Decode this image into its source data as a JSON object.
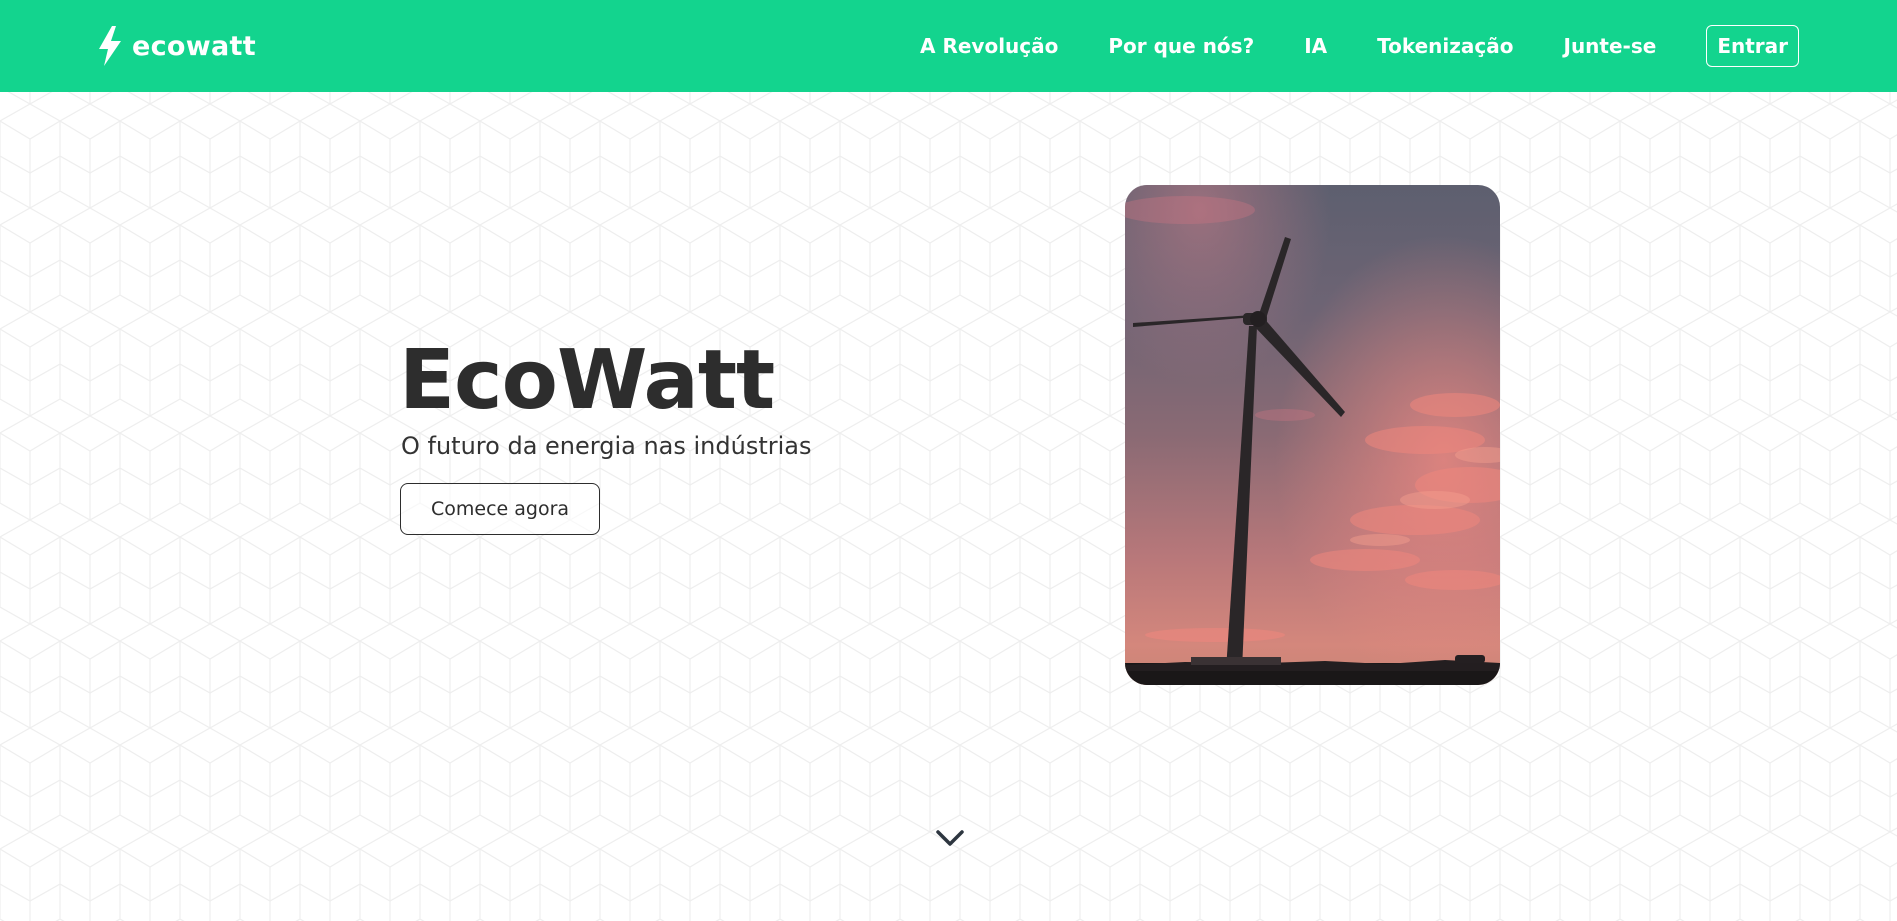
{
  "brand": {
    "name": "ecowatt",
    "icon": "lightning-bolt-icon"
  },
  "nav": {
    "links": [
      {
        "label": "A Revolução"
      },
      {
        "label": "Por que nós?"
      },
      {
        "label": "IA"
      },
      {
        "label": "Tokenização"
      },
      {
        "label": "Junte-se"
      }
    ],
    "login_label": "Entrar"
  },
  "hero": {
    "title": "EcoWatt",
    "subtitle": "O futuro da energia nas indústrias",
    "cta_label": "Comece agora",
    "image": "wind-turbine-at-sunset"
  },
  "scroll_indicator": {
    "icon": "chevron-down-icon"
  },
  "colors": {
    "brand_green": "#13d48e",
    "text_dark": "#2d2d2d",
    "white": "#ffffff"
  }
}
